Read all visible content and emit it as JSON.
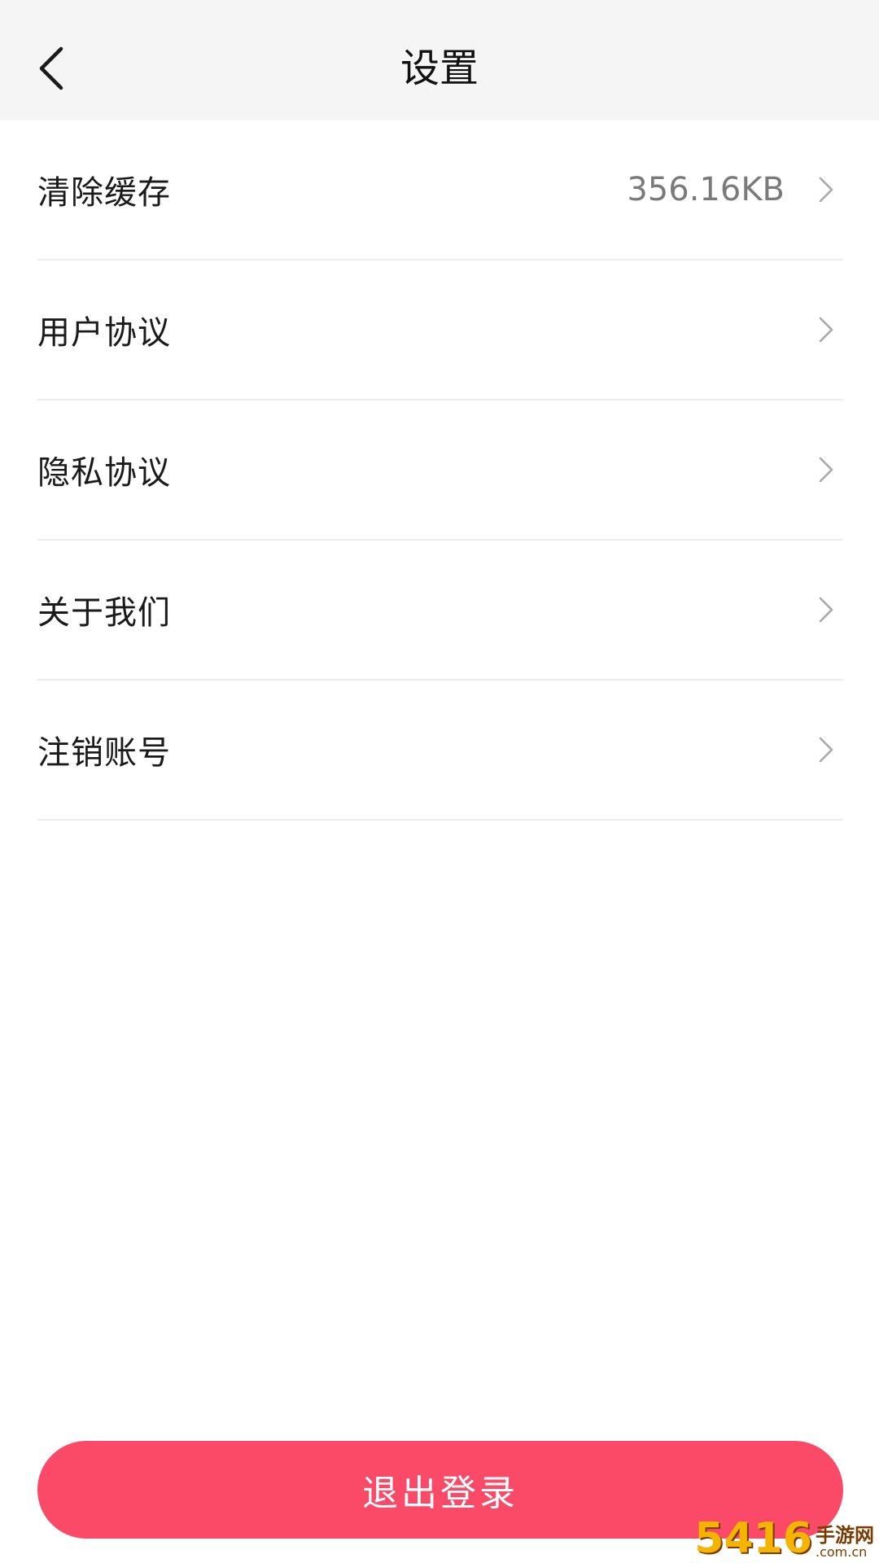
{
  "header": {
    "title": "设置",
    "back_icon": "chevron-left-icon"
  },
  "settings": {
    "items": [
      {
        "label": "清除缓存",
        "value": "356.16KB"
      },
      {
        "label": "用户协议"
      },
      {
        "label": "隐私协议"
      },
      {
        "label": "关于我们"
      },
      {
        "label": "注销账号"
      }
    ]
  },
  "logout": {
    "label": "退出登录"
  },
  "colors": {
    "header_bg": "#f5f5f5",
    "accent": "#fb4a68",
    "divider": "#ececec"
  },
  "watermark": {
    "number": "5416",
    "name": "手游网",
    "domain": ".com.cn"
  }
}
